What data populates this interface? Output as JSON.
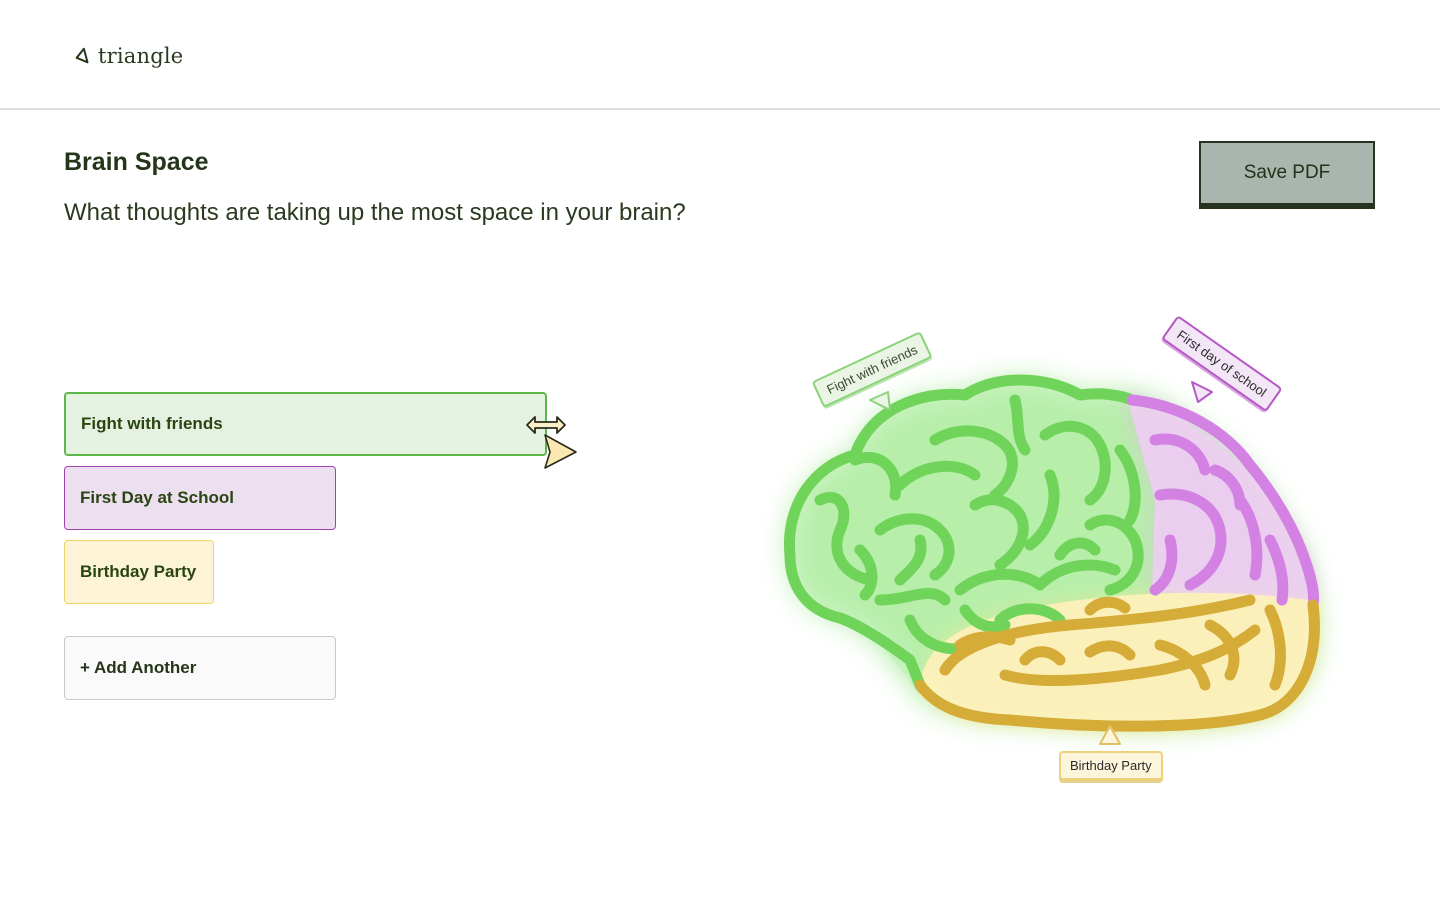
{
  "app": {
    "logo_text": "triangle"
  },
  "page": {
    "title": "Brain Space",
    "subtitle": "What thoughts are taking up the most space in your brain?"
  },
  "actions": {
    "save_pdf_label": "Save PDF"
  },
  "thoughts": [
    {
      "label": "Fight with friends",
      "color": "#5db84a",
      "share": 0.55
    },
    {
      "label": "First Day at School",
      "color": "#b64fc6",
      "share": 0.2
    },
    {
      "label": "Birthday Party",
      "color": "#e0b640",
      "share": 0.25
    }
  ],
  "add_button_label": "+ Add Another",
  "brain_tags": {
    "green": "Fight with friends",
    "purple": "First day of school",
    "yellow": "Birthday Party"
  },
  "colors": {
    "green": "#5fd44a",
    "purple": "#cf7be0",
    "yellow": "#d4ac37",
    "dark_ink": "#26351a"
  }
}
